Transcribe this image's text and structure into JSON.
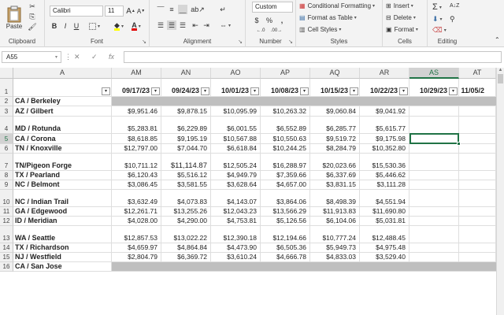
{
  "ribbon": {
    "clipboard": {
      "paste": "Paste",
      "label": "Clipboard"
    },
    "font": {
      "name": "Calibri",
      "size": "11",
      "label": "Font",
      "bold": "B",
      "italic": "I",
      "underline": "U",
      "grow": "A",
      "shrink": "A",
      "fill_color": "#ffff00",
      "font_color": "#e00000"
    },
    "alignment": {
      "label": "Alignment"
    },
    "number": {
      "format": "Custom",
      "currency": "$",
      "percent": "%",
      "comma": ",",
      "label": "Number"
    },
    "styles": {
      "conditional": "Conditional Formatting",
      "table": "Format as Table",
      "cell": "Cell Styles",
      "label": "Styles"
    },
    "cells": {
      "insert": "Insert",
      "delete": "Delete",
      "format": "Format",
      "label": "Cells"
    },
    "editing": {
      "label": "Editing",
      "sum": "Σ",
      "sort": "A↓Z",
      "find": "⚲"
    }
  },
  "formula_bar": {
    "name_box": "A55",
    "cancel": "✕",
    "enter": "✓",
    "fx": "fx",
    "value": ""
  },
  "columns": [
    "A",
    "AM",
    "AN",
    "AO",
    "AP",
    "AQ",
    "AR",
    "AS",
    "AT"
  ],
  "selected_column": "AS",
  "header_dates": [
    "09/17/23",
    "09/24/23",
    "10/01/23",
    "10/08/23",
    "10/15/23",
    "10/22/23",
    "10/29/23",
    "11/05/2"
  ],
  "filter_glyph": "▾",
  "rows": [
    {
      "num": "1",
      "city": "",
      "values": [
        "",
        "",
        "",
        "",
        "",
        "",
        "",
        ""
      ]
    },
    {
      "num": "2",
      "city": "CA / Berkeley",
      "values": [
        "",
        "",
        "",
        "",
        "",
        "",
        "",
        ""
      ],
      "gray": true
    },
    {
      "num": "3",
      "city": "AZ / Gilbert",
      "values": [
        "$9,951.46",
        "$9,878.15",
        "$10,095.99",
        "$10,263.32",
        "$9,060.84",
        "$9,041.92",
        "",
        ""
      ]
    },
    {
      "num": "4",
      "city": "MD / Rotunda",
      "values": [
        "$5,283.81",
        "$6,229.89",
        "$6,001.55",
        "$6,552.89",
        "$6,285.77",
        "$5,615.77",
        "",
        ""
      ]
    },
    {
      "num": "5",
      "city": "CA / Corona",
      "values": [
        "$8,618.85",
        "$9,195.19",
        "$10,567.88",
        "$10,550.63",
        "$9,519.72",
        "$9,175.98",
        "",
        ""
      ]
    },
    {
      "num": "6",
      "city": "TN / Knoxville",
      "values": [
        "$12,797.00",
        "$7,044.70",
        "$6,618.84",
        "$10,244.25",
        "$8,284.79",
        "$10,352.80",
        "",
        ""
      ]
    },
    {
      "num": "7",
      "city": "TN/Pigeon Forge",
      "values": [
        "$10,711.12",
        "$11,114.87",
        "$12,505.24",
        "$16,288.97",
        "$20,023.66",
        "$15,530.36",
        "",
        ""
      ]
    },
    {
      "num": "8",
      "city": "TX / Pearland",
      "values": [
        "$6,120.43",
        "$5,516.12",
        "$4,949.79",
        "$7,359.66",
        "$6,337.69",
        "$5,446.62",
        "",
        ""
      ]
    },
    {
      "num": "9",
      "city": "NC / Belmont",
      "values": [
        "$3,086.45",
        "$3,581.55",
        "$3,628.64",
        "$4,657.00",
        "$3,831.15",
        "$3,111.28",
        "",
        ""
      ]
    },
    {
      "num": "10",
      "city": "NC / Indian Trail",
      "values": [
        "$3,632.49",
        "$4,073.83",
        "$4,143.07",
        "$3,864.06",
        "$8,498.39",
        "$4,551.94",
        "",
        ""
      ]
    },
    {
      "num": "11",
      "city": "GA / Edgewood",
      "values": [
        "$12,261.71",
        "$13,255.26",
        "$12,043.23",
        "$13,566.29",
        "$11,913.83",
        "$11,690.80",
        "",
        ""
      ]
    },
    {
      "num": "12",
      "city": "ID / Meridian",
      "values": [
        "$4,028.00",
        "$4,290.00",
        "$4,753.81",
        "$5,126.56",
        "$6,104.06",
        "$5,031.81",
        "",
        ""
      ]
    },
    {
      "num": "13",
      "city": "WA / Seattle",
      "values": [
        "$12,857.53",
        "$13,022.22",
        "$12,390.18",
        "$12,194.66",
        "$10,777.24",
        "$12,488.45",
        "",
        ""
      ]
    },
    {
      "num": "14",
      "city": "TX / Richardson",
      "values": [
        "$4,659.97",
        "$4,864.84",
        "$4,473.90",
        "$6,505.36",
        "$5,949.73",
        "$4,975.48",
        "",
        ""
      ]
    },
    {
      "num": "15",
      "city": "NJ / Westfield",
      "values": [
        "$2,804.79",
        "$6,369.72",
        "$3,610.24",
        "$4,666.78",
        "$4,833.03",
        "$3,529.40",
        "",
        ""
      ]
    },
    {
      "num": "16",
      "city": "CA / San Jose",
      "values": [
        "",
        "",
        "",
        "",
        "",
        "",
        "",
        ""
      ],
      "gray": true
    }
  ],
  "colors": {
    "ribbon_bg": "#f3f3f3",
    "selection": "#217346",
    "gray_band": "#bfbfbf"
  }
}
